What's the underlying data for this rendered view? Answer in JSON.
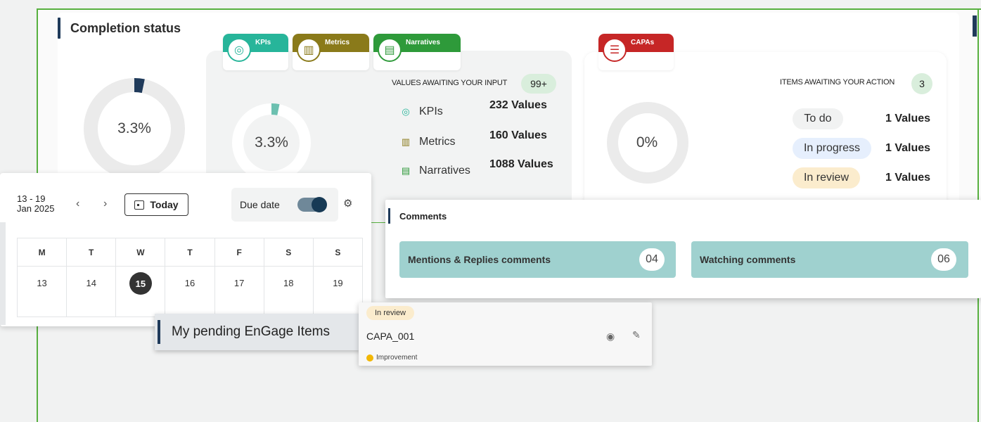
{
  "completion": {
    "title": "Completion status",
    "overall_percent": "3.3%",
    "values_percent": "3.3%",
    "capa_percent": "0%"
  },
  "tabs": {
    "kpis": "KPIs",
    "metrics": "Metrics",
    "narratives": "Narratives",
    "capas": "CAPAs"
  },
  "values": {
    "title": "VALUES AWAITING YOUR INPUT",
    "count": "99+",
    "rows": [
      {
        "label": "KPIs",
        "value": "232 Values"
      },
      {
        "label": "Metrics",
        "value": "160 Values"
      },
      {
        "label": "Narratives",
        "value": "1088 Values"
      }
    ]
  },
  "actions": {
    "title": "ITEMS AWAITING YOUR ACTION",
    "count": "3",
    "rows": [
      {
        "label": "To do",
        "value": "1 Values",
        "color": "#f1f2f2"
      },
      {
        "label": "In progress",
        "value": "1 Values",
        "color": "#e6effd"
      },
      {
        "label": "In review",
        "value": "1 Values",
        "color": "#fbeccd"
      }
    ]
  },
  "calendar": {
    "range_line1": "13 - 19",
    "range_line2": "Jan 2025",
    "prev": "‹",
    "next": "›",
    "today_label": "Today",
    "due_label": "Due date",
    "days": [
      "M",
      "T",
      "W",
      "T",
      "F",
      "S",
      "S"
    ],
    "dates": [
      "13",
      "14",
      "15",
      "16",
      "17",
      "18",
      "19"
    ]
  },
  "comments": {
    "title": "Comments",
    "mentions_label": "Mentions & Replies comments",
    "mentions_count": "04",
    "watching_label": "Watching comments",
    "watching_count": "06"
  },
  "pending": {
    "title": "My pending EnGage Items",
    "status": "In review",
    "item": "CAPA_001",
    "type": "Improvement"
  },
  "colors": {
    "kpi_green": "#27b59a",
    "metrics_gold": "#8a7a1a",
    "narratives_green": "#2e9a3a",
    "capa_red": "#c62626",
    "frame_green": "#57b03f",
    "accent_navy": "#1f3a5a"
  }
}
